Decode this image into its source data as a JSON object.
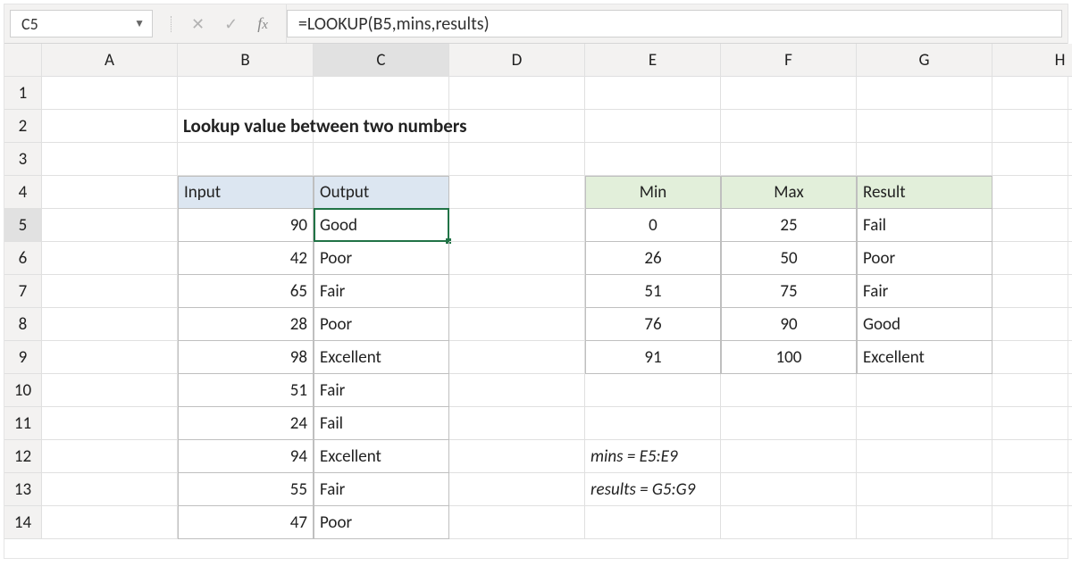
{
  "formula_bar": {
    "namebox": "C5",
    "formula": "=LOOKUP(B5,mins,results)"
  },
  "columns": [
    "A",
    "B",
    "C",
    "D",
    "E",
    "F",
    "G",
    "H"
  ],
  "rows": [
    "1",
    "2",
    "3",
    "4",
    "5",
    "6",
    "7",
    "8",
    "9",
    "10",
    "11",
    "12",
    "13",
    "14"
  ],
  "title": "Lookup value between two numbers",
  "io_headers": {
    "input": "Input",
    "output": "Output"
  },
  "io_data": [
    {
      "input": "90",
      "output": "Good"
    },
    {
      "input": "42",
      "output": "Poor"
    },
    {
      "input": "65",
      "output": "Fair"
    },
    {
      "input": "28",
      "output": "Poor"
    },
    {
      "input": "98",
      "output": "Excellent"
    },
    {
      "input": "51",
      "output": "Fair"
    },
    {
      "input": "24",
      "output": "Fail"
    },
    {
      "input": "94",
      "output": "Excellent"
    },
    {
      "input": "55",
      "output": "Fair"
    },
    {
      "input": "47",
      "output": "Poor"
    }
  ],
  "lookup_headers": {
    "min": "Min",
    "max": "Max",
    "result": "Result"
  },
  "lookup_data": [
    {
      "min": "0",
      "max": "25",
      "result": "Fail"
    },
    {
      "min": "26",
      "max": "50",
      "result": "Poor"
    },
    {
      "min": "51",
      "max": "75",
      "result": "Fair"
    },
    {
      "min": "76",
      "max": "90",
      "result": "Good"
    },
    {
      "min": "91",
      "max": "100",
      "result": "Excellent"
    }
  ],
  "notes": {
    "mins": "mins = E5:E9",
    "results": "results = G5:G9"
  },
  "selection": {
    "cell": "C5"
  }
}
